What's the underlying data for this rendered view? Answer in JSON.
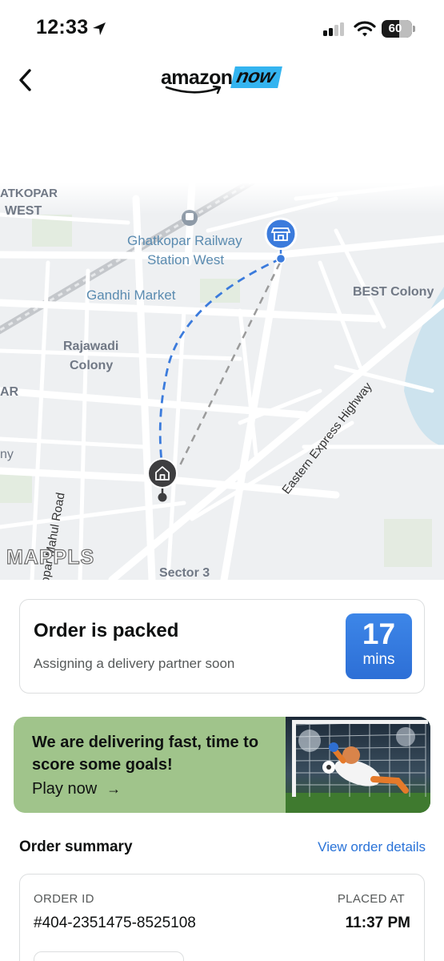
{
  "status_bar": {
    "time": "12:33",
    "battery": "60"
  },
  "header": {
    "logo_amazon": "amazon",
    "logo_now": "now"
  },
  "map": {
    "labels": {
      "atkopar": "ATKOPAR",
      "west": "WEST",
      "station_line1": "Ghatkopar Railway",
      "station_line2": "Station West",
      "gandhi_market": "Gandhi Market",
      "best_colony": "BEST Colony",
      "rajawadi_line1": "Rajawadi",
      "rajawadi_line2": "Colony",
      "ar": "AR",
      "ny": "ny",
      "highway": "Eastern Express Highway",
      "mahul_road": "Ghatkopar Mahul Road",
      "sector": "Sector 3"
    },
    "watermark": "MAPPLS",
    "store_icon": "store-icon",
    "home_icon": "home-icon"
  },
  "order_status": {
    "title": "Order is packed",
    "subtitle": "Assigning a delivery partner soon",
    "eta_value": "17",
    "eta_unit": "mins"
  },
  "promo": {
    "title": "We are delivering fast, time to score some goals!",
    "cta": "Play now",
    "cta_arrow": "→",
    "image": "goalkeeper-illustration"
  },
  "order_summary": {
    "title": "Order summary",
    "link": "View order details",
    "order_id_label": "ORDER ID",
    "order_id_value": "#404-2351475-8525108",
    "placed_label": "PLACED AT",
    "placed_value": "11:37 PM"
  },
  "colors": {
    "accent_blue": "#2a73d8",
    "eta_badge": "#3d86e8",
    "promo_bg": "#a0c48b",
    "logo_now_bg": "#34b4f0",
    "route_blue": "#3b7bdc"
  }
}
